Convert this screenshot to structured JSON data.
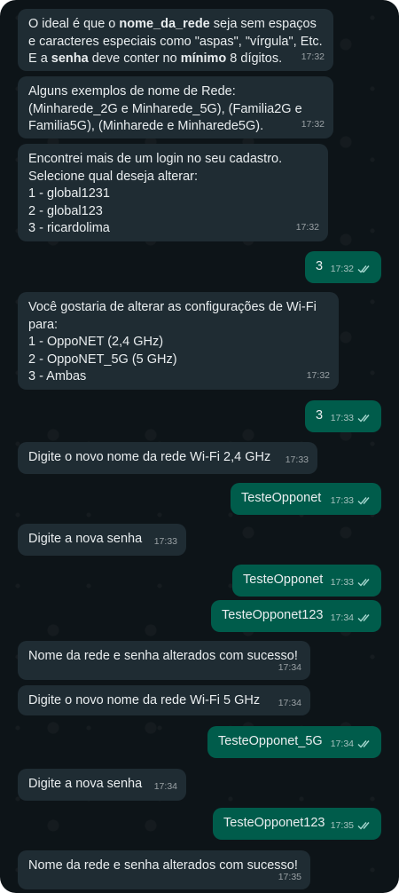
{
  "messages": [
    {
      "dir": "in",
      "segments": [
        {
          "t": "O ideal é que o ",
          "b": false
        },
        {
          "t": "nome_da_rede",
          "b": true
        },
        {
          "t": " seja sem espaços e caracteres especiais como \"aspas\", \"vírgula\", Etc. E a ",
          "b": false
        },
        {
          "t": "senha",
          "b": true
        },
        {
          "t": " deve conter no ",
          "b": false
        },
        {
          "t": "mínimo",
          "b": true
        },
        {
          "t": " 8 dígitos.",
          "b": false
        }
      ],
      "time": "17:32"
    },
    {
      "dir": "in",
      "text": "Alguns exemplos de nome de Rede: (Minharede_2G e Minharede_5G), (Familia2G e Familia5G), (Minharede e Minharede5G).",
      "time": "17:32"
    },
    {
      "dir": "in",
      "text": "Encontrei mais de um login no seu cadastro.\nSelecione qual deseja alterar:\n1 - global1231\n2 - global123\n3 - ricardolima",
      "time": "17:32"
    },
    {
      "dir": "out",
      "text": "3",
      "time": "17:32"
    },
    {
      "dir": "in",
      "text": "Você gostaria de alterar as configurações de Wi-Fi para:\n1 - OppoNET (2,4 GHz)\n2 - OppoNET_5G (5 GHz)\n3 - Ambas",
      "time": "17:32"
    },
    {
      "dir": "out",
      "text": "3",
      "time": "17:33"
    },
    {
      "dir": "in",
      "text": "Digite o novo nome da rede Wi-Fi 2,4 GHz",
      "time": "17:33"
    },
    {
      "dir": "out",
      "text": "TesteOpponet",
      "time": "17:33"
    },
    {
      "dir": "in",
      "text": "Digite a nova senha",
      "time": "17:33"
    },
    {
      "dir": "out",
      "text": "TesteOpponet",
      "time": "17:33"
    },
    {
      "dir": "out",
      "text": "TesteOpponet123",
      "time": "17:34"
    },
    {
      "dir": "in",
      "text": "Nome da rede e senha alterados com sucesso!",
      "time": "17:34"
    },
    {
      "dir": "in",
      "text": "Digite o novo nome da rede Wi-Fi 5 GHz",
      "time": "17:34"
    },
    {
      "dir": "out",
      "text": "TesteOpponet_5G",
      "time": "17:34"
    },
    {
      "dir": "in",
      "text": "Digite a nova senha",
      "time": "17:34"
    },
    {
      "dir": "out",
      "text": "TesteOpponet123",
      "time": "17:35"
    },
    {
      "dir": "in",
      "text": "Nome da rede e senha alterados com sucesso!",
      "time": "17:35"
    }
  ],
  "icons": {
    "read_receipt": "double-check-icon"
  },
  "colors": {
    "background": "#0d1418",
    "incoming": "#1f2c33",
    "outgoing": "#005c4b",
    "read_tick": "#a5d7cf"
  }
}
